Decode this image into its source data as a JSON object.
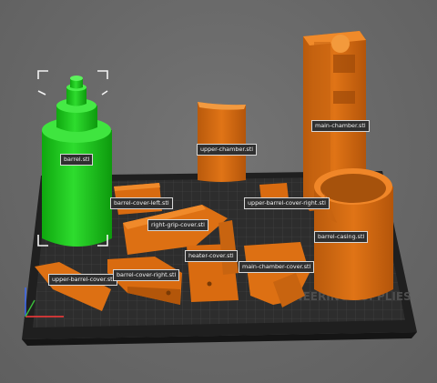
{
  "scene": {
    "bed_color": "#2b2b2b",
    "grid_color": "#4a4a4a",
    "bed_logo_text": "ENGINEERING SUPPLIES",
    "part_color": "#d96b10",
    "selected_color": "#16c516",
    "axis_colors": {
      "x": "#ff3b3b",
      "y": "#3bbf3b",
      "z": "#3b6bff"
    }
  },
  "objects": [
    {
      "id": "barrel",
      "label": "barrel.stl",
      "selected": true
    },
    {
      "id": "upper-chamber",
      "label": "upper-chamber.stl",
      "selected": false
    },
    {
      "id": "main-chamber",
      "label": "main-chamber.stl",
      "selected": false
    },
    {
      "id": "barrel-cover-left",
      "label": "barrel-cover-left.stl",
      "selected": false
    },
    {
      "id": "upper-barrel-cover-right",
      "label": "upper-barrel-cover-right.stl",
      "selected": false
    },
    {
      "id": "right-grip-cover",
      "label": "right-grip-cover.stl",
      "selected": false
    },
    {
      "id": "barrel-casing",
      "label": "barrel-casing.stl",
      "selected": false
    },
    {
      "id": "heater-cover",
      "label": "heater-cover.stl",
      "selected": false
    },
    {
      "id": "main-chamber-cover",
      "label": "main-chamber-cover.stl",
      "selected": false
    },
    {
      "id": "upper-barrel-cover",
      "label": "upper-barrel-cover.stl",
      "selected": false
    },
    {
      "id": "barrel-cover-right",
      "label": "barrel-cover-right.stl",
      "selected": false
    }
  ]
}
